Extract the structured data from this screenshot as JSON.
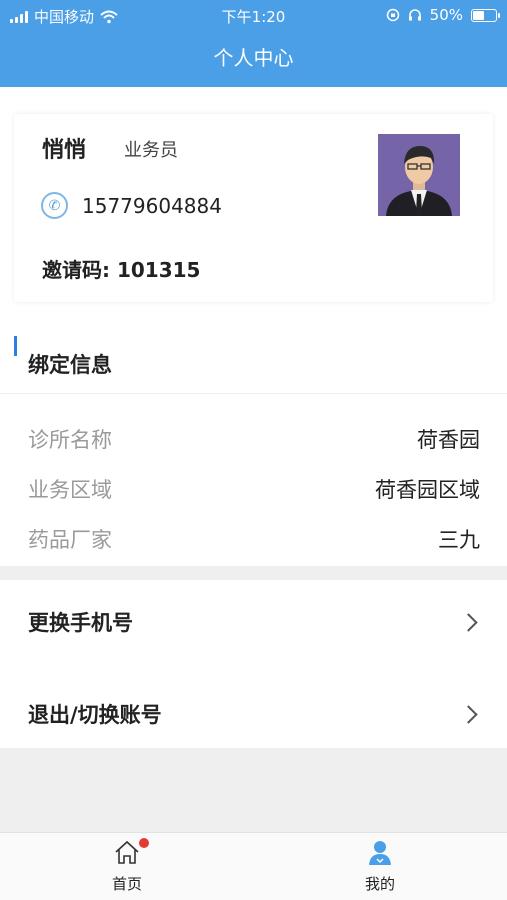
{
  "status_bar": {
    "carrier": "中国移动",
    "time": "下午1:20",
    "battery": "50%",
    "battery_level": 0.5
  },
  "header": {
    "title": "个人中心"
  },
  "profile": {
    "name": "悄悄",
    "role": "业务员",
    "phone": "15779604884",
    "invite_label": "邀请码:",
    "invite_code": "101315"
  },
  "bind_info": {
    "title": "绑定信息",
    "rows": [
      {
        "label": "诊所名称",
        "value": "荷香园"
      },
      {
        "label": "业务区域",
        "value": "荷香园区域"
      },
      {
        "label": "药品厂家",
        "value": "三九"
      }
    ]
  },
  "menu": [
    {
      "label": "更换手机号"
    },
    {
      "label": "退出/切换账号"
    }
  ],
  "tabs": [
    {
      "label": "首页",
      "icon": "home-icon",
      "badge": true
    },
    {
      "label": "我的",
      "icon": "user-icon",
      "active": true
    }
  ],
  "colors": {
    "header": "#4a9fe6",
    "accent": "#2f7de1",
    "badge": "#e53935"
  }
}
